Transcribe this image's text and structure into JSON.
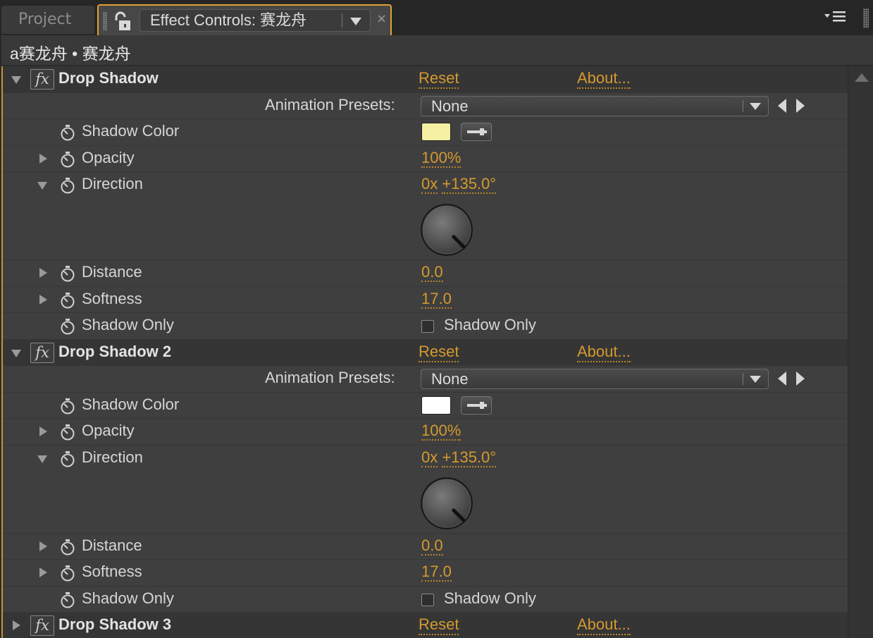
{
  "tabs": {
    "project_label": "Project",
    "effect_controls_title": "Effect Controls: 赛龙舟",
    "close_glyph": "×"
  },
  "panel": {
    "breadcrumb": "a赛龙舟 • 赛龙舟"
  },
  "labels": {
    "reset": "Reset",
    "about": "About...",
    "animation_presets": "Animation Presets:",
    "preset_none": "None",
    "shadow_color": "Shadow Color",
    "opacity": "Opacity",
    "direction": "Direction",
    "distance": "Distance",
    "softness": "Softness",
    "shadow_only": "Shadow Only"
  },
  "effects": [
    {
      "name": "Drop Shadow",
      "shadow_color": "#f4efa3",
      "opacity": "100%",
      "direction_revs": "0x",
      "direction_angle": "+135.0°",
      "direction_degrees": 135,
      "distance": "0.0",
      "softness": "17.0",
      "shadow_only_checked": false
    },
    {
      "name": "Drop Shadow 2",
      "shadow_color": "#ffffff",
      "opacity": "100%",
      "direction_revs": "0x",
      "direction_angle": "+135.0°",
      "direction_degrees": 135,
      "distance": "0.0",
      "softness": "17.0",
      "shadow_only_checked": false
    },
    {
      "name": "Drop Shadow 3"
    }
  ],
  "colors": {
    "accent": "#e2a135",
    "link": "#d49a2e"
  }
}
